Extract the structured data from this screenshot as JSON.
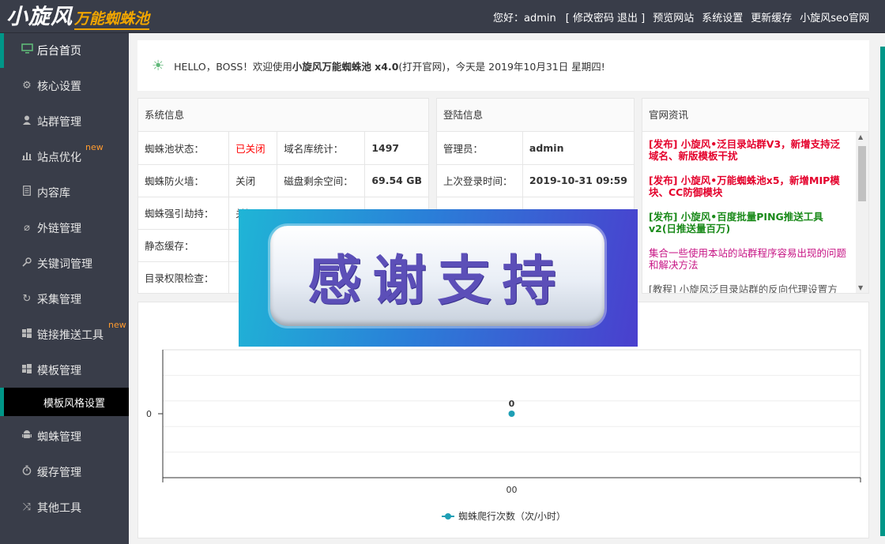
{
  "header": {
    "logo_main": "小旋风",
    "logo_sub": "万能蜘蛛池",
    "greeting": "您好：admin",
    "change_pwd": "[ 修改密码",
    "logout": "退出 ]",
    "preview": "预览网站",
    "settings": "系统设置",
    "cache": "更新缓存",
    "official": "小旋风seo官网"
  },
  "sidebar": {
    "items": [
      {
        "label": "后台首页",
        "icon": "monitor-icon"
      },
      {
        "label": "核心设置",
        "icon": "gear-icon"
      },
      {
        "label": "站群管理",
        "icon": "user-icon"
      },
      {
        "label": "站点优化",
        "icon": "bar-chart-icon",
        "badge": "new"
      },
      {
        "label": "内容库",
        "icon": "document-icon"
      },
      {
        "label": "外链管理",
        "icon": "link-icon"
      },
      {
        "label": "关键词管理",
        "icon": "key-icon"
      },
      {
        "label": "采集管理",
        "icon": "refresh-icon"
      },
      {
        "label": "链接推送工具",
        "icon": "windows-icon",
        "badge": "new"
      },
      {
        "label": "模板管理",
        "icon": "windows-icon"
      },
      {
        "label": "蜘蛛管理",
        "icon": "android-icon"
      },
      {
        "label": "缓存管理",
        "icon": "timer-icon"
      },
      {
        "label": "其他工具",
        "icon": "shuffle-icon"
      }
    ],
    "sub_item": "模板风格设置"
  },
  "welcome": {
    "prefix": "HELLO，BOSS！欢迎使用 ",
    "product": "小旋风万能蜘蛛池 x4.0",
    "suffix": " (打开官网)，今天是 2019年10月31日 星期四!"
  },
  "system_info": {
    "title": "系统信息",
    "rows": [
      [
        "蜘蛛池状态：",
        "已关闭",
        "域名库统计：",
        "1497"
      ],
      [
        "蜘蛛防火墙：",
        "关闭",
        "磁盘剩余空间：",
        "69.54 GB"
      ],
      [
        "蜘蛛强引劫持：",
        "关闭",
        "",
        ""
      ],
      [
        "静态缓存：",
        "",
        "",
        ""
      ],
      [
        "目录权限检查：",
        "",
        "",
        ""
      ]
    ]
  },
  "login_info": {
    "title": "登陆信息",
    "rows": [
      [
        "管理员：",
        "admin"
      ],
      [
        "上次登录时间：",
        "2019-10-31 09:59"
      ]
    ]
  },
  "news": {
    "title": "官网资讯",
    "items": [
      {
        "text": "[发布] 小旋风•泛目录站群V3，新增支持泛域名、新版模板干扰",
        "color": "#e4002b",
        "bold": true
      },
      {
        "text": "[发布] 小旋风•万能蜘蛛池x5，新增MIP模块、CC防御模块",
        "color": "#e4002b",
        "bold": true
      },
      {
        "text": "[发布] 小旋风•百度批量PING推送工具v2(日推送量百万)",
        "color": "#1a8a1a",
        "bold": true
      },
      {
        "text": "集合一些使用本站的站群程序容易出现的问题和解决方法",
        "color": "#c71585",
        "bold": false
      },
      {
        "text": "[教程] 小旋风泛目录站群的反向代理设置方",
        "color": "#555555",
        "bold": false
      }
    ]
  },
  "overlay": {
    "text": "感谢支持"
  },
  "chart_data": {
    "type": "line",
    "categories": [
      "00"
    ],
    "series": [
      {
        "name": "蜘蛛爬行次数（次/小时）",
        "values": [
          0
        ]
      }
    ],
    "data_labels": [
      "0"
    ],
    "y_ticks": [
      "0"
    ],
    "color": "#1e9fb5",
    "grid": true,
    "legend": "bottom"
  }
}
